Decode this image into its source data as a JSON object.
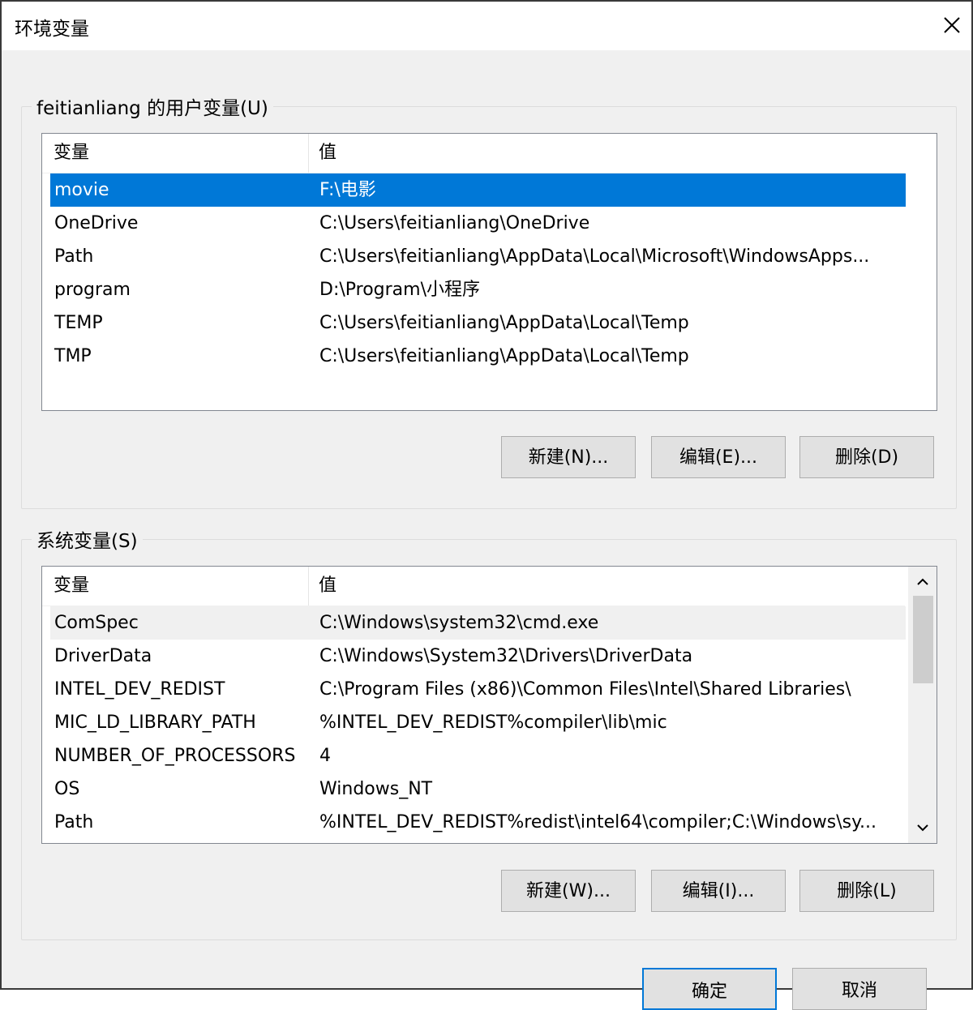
{
  "window": {
    "title": "环境变量"
  },
  "user_vars": {
    "legend": "feitianliang 的用户变量(U)",
    "columns": [
      "变量",
      "值"
    ],
    "rows": [
      {
        "name": "movie",
        "value": "F:\\电影"
      },
      {
        "name": "OneDrive",
        "value": "C:\\Users\\feitianliang\\OneDrive"
      },
      {
        "name": "Path",
        "value": "C:\\Users\\feitianliang\\AppData\\Local\\Microsoft\\WindowsApps..."
      },
      {
        "name": "program",
        "value": "D:\\Program\\小程序"
      },
      {
        "name": "TEMP",
        "value": "C:\\Users\\feitianliang\\AppData\\Local\\Temp"
      },
      {
        "name": "TMP",
        "value": "C:\\Users\\feitianliang\\AppData\\Local\\Temp"
      }
    ],
    "buttons": {
      "new": "新建(N)...",
      "edit": "编辑(E)...",
      "delete": "删除(D)"
    }
  },
  "system_vars": {
    "legend": "系统变量(S)",
    "columns": [
      "变量",
      "值"
    ],
    "rows": [
      {
        "name": "ComSpec",
        "value": "C:\\Windows\\system32\\cmd.exe"
      },
      {
        "name": "DriverData",
        "value": "C:\\Windows\\System32\\Drivers\\DriverData"
      },
      {
        "name": "INTEL_DEV_REDIST",
        "value": "C:\\Program Files (x86)\\Common Files\\Intel\\Shared Libraries\\"
      },
      {
        "name": "MIC_LD_LIBRARY_PATH",
        "value": "%INTEL_DEV_REDIST%compiler\\lib\\mic"
      },
      {
        "name": "NUMBER_OF_PROCESSORS",
        "value": "4"
      },
      {
        "name": "OS",
        "value": "Windows_NT"
      },
      {
        "name": "Path",
        "value": "%INTEL_DEV_REDIST%redist\\intel64\\compiler;C:\\Windows\\sy..."
      }
    ],
    "buttons": {
      "new": "新建(W)...",
      "edit": "编辑(I)...",
      "delete": "删除(L)"
    }
  },
  "footer": {
    "ok": "确定",
    "cancel": "取消"
  },
  "icons": {
    "close": "close-icon",
    "up": "chevron-up-icon",
    "down": "chevron-down-icon"
  },
  "colors": {
    "selection": "#0078d7",
    "primary_border": "#0078d7"
  }
}
